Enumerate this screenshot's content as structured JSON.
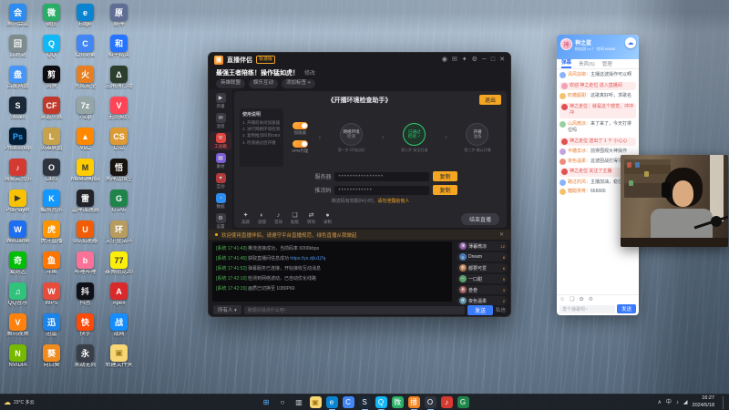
{
  "desktop": {
    "icons": [
      {
        "label": "腾讯会议",
        "color": "#2d8cf0",
        "glyph": "会"
      },
      {
        "label": "回收站",
        "color": "#7f8c8d",
        "glyph": "回"
      },
      {
        "label": "百度网盘",
        "color": "#4696fa",
        "glyph": "盘"
      },
      {
        "label": "Steam",
        "color": "#1b2838",
        "glyph": "S"
      },
      {
        "label": "Photoshop",
        "color": "#001e36",
        "glyph": "Ps",
        "fg": "#31a8ff"
      },
      {
        "label": "网易云音乐",
        "color": "#d33a31",
        "glyph": "♪"
      },
      {
        "label": "PotPlayer",
        "color": "#f8c200",
        "glyph": "▶",
        "fg": "#333"
      },
      {
        "label": "WeGame",
        "color": "#1d6ef0",
        "glyph": "W"
      },
      {
        "label": "爱奇艺",
        "color": "#00be06",
        "glyph": "奇"
      },
      {
        "label": "QQ音乐",
        "color": "#31c27c",
        "glyph": "♫"
      },
      {
        "label": "腾讯视频",
        "color": "#ff820f",
        "glyph": "V"
      },
      {
        "label": "NVIDIA",
        "color": "#76b900",
        "glyph": "N"
      },
      {
        "label": "微信",
        "color": "#2aae67",
        "glyph": "微"
      },
      {
        "label": "QQ",
        "color": "#12b7f5",
        "glyph": "Q"
      },
      {
        "label": "剪映",
        "color": "#0e0e12",
        "glyph": "剪"
      },
      {
        "label": "穿越火线",
        "color": "#c0392b",
        "glyph": "CF"
      },
      {
        "label": "英雄联盟",
        "color": "#c8a24b",
        "glyph": "L"
      },
      {
        "label": "OBS",
        "color": "#2f343f",
        "glyph": "O"
      },
      {
        "label": "酷狗音乐",
        "color": "#1298ff",
        "glyph": "K"
      },
      {
        "label": "虎牙直播",
        "color": "#ff9600",
        "glyph": "虎"
      },
      {
        "label": "斗鱼",
        "color": "#ff7500",
        "glyph": "鱼"
      },
      {
        "label": "WPS",
        "color": "#e84c3d",
        "glyph": "W"
      },
      {
        "label": "迅雷",
        "color": "#1c83e9",
        "glyph": "迅"
      },
      {
        "label": "向日葵",
        "color": "#f08c1e",
        "glyph": "葵"
      },
      {
        "label": "Edge",
        "color": "#0a84d0",
        "glyph": "e"
      },
      {
        "label": "Chrome",
        "color": "#4285f4",
        "glyph": "C"
      },
      {
        "label": "火绒安全",
        "color": "#e67e22",
        "glyph": "火"
      },
      {
        "label": "7-Zip",
        "color": "#95a5a6",
        "glyph": "7z"
      },
      {
        "label": "VLC",
        "color": "#ff8800",
        "glyph": "▲"
      },
      {
        "label": "MuMu模拟器",
        "color": "#ffcc00",
        "glyph": "M",
        "fg": "#333"
      },
      {
        "label": "雷神加速器",
        "color": "#23242a",
        "glyph": "雷"
      },
      {
        "label": "UU加速器",
        "color": "#f25c05",
        "glyph": "U"
      },
      {
        "label": "哔哩哔哩",
        "color": "#fb7299",
        "glyph": "b"
      },
      {
        "label": "抖音",
        "color": "#101018",
        "glyph": "抖"
      },
      {
        "label": "快手",
        "color": "#ff4906",
        "glyph": "快"
      },
      {
        "label": "永劫无间",
        "color": "#3a3f47",
        "glyph": "永"
      },
      {
        "label": "原神",
        "color": "#5f6e94",
        "glyph": "原"
      },
      {
        "label": "和平精英",
        "color": "#2574ff",
        "glyph": "和"
      },
      {
        "label": "三角洲行动",
        "color": "#2c3e2e",
        "glyph": "Δ"
      },
      {
        "label": "无畏契约",
        "color": "#fd4556",
        "glyph": "V"
      },
      {
        "label": "CS2",
        "color": "#de9b35",
        "glyph": "CS"
      },
      {
        "label": "黑神话悟空",
        "color": "#17130f",
        "glyph": "悟"
      },
      {
        "label": "GTA5",
        "color": "#1e8449",
        "glyph": "G"
      },
      {
        "label": "艾尔登法环",
        "color": "#b79b5f",
        "glyph": "环"
      },
      {
        "label": "赛博朋克2077",
        "color": "#fcee0a",
        "glyph": "77",
        "fg": "#333"
      },
      {
        "label": "Apex",
        "color": "#da292a",
        "glyph": "A"
      },
      {
        "label": "战网",
        "color": "#148eff",
        "glyph": "战"
      },
      {
        "label": "新建文件夹",
        "color": "#f7d674",
        "glyph": "▣",
        "fg": "#a07c1e"
      }
    ]
  },
  "app": {
    "title": "直播伴侣",
    "logo_glyph": "播",
    "version": "极速版",
    "titlebar_icons": [
      {
        "name": "user-icon",
        "glyph": "◉"
      },
      {
        "name": "message-icon",
        "glyph": "✉"
      },
      {
        "name": "skin-icon",
        "glyph": "✦"
      },
      {
        "name": "settings-icon",
        "glyph": "⚙"
      },
      {
        "name": "minimize-icon",
        "glyph": "─"
      },
      {
        "name": "maximize-icon",
        "glyph": "□"
      },
      {
        "name": "close-icon",
        "glyph": "✕"
      }
    ],
    "room": {
      "title": "最强王者陪练！操作猛如虎！",
      "edit": "修改",
      "tags": [
        "英雄联盟",
        "娱乐互动",
        "添加标签 +"
      ]
    },
    "nav": [
      {
        "label": "开播",
        "glyph": "▶",
        "color": "#3a3a42",
        "active": false
      },
      {
        "label": "消息",
        "glyph": "✉",
        "color": "#3a3a42",
        "active": false
      },
      {
        "label": "工具箱",
        "glyph": "⚒",
        "color": "#e0443e",
        "active": true
      },
      {
        "label": "素材",
        "glyph": "▦",
        "color": "#7b5bd6",
        "active": false
      },
      {
        "label": "互动",
        "glyph": "♥",
        "color": "#b03a3a",
        "active": false
      },
      {
        "label": "数据",
        "glyph": "◔",
        "color": "#2d8cf0",
        "active": false
      },
      {
        "label": "设置",
        "glyph": "⚙",
        "color": "#3a3a42",
        "active": false
      }
    ],
    "wizard": {
      "title": "《开播环境检查助手》",
      "exit": "退出",
      "note_title": "使用说明",
      "note_lines": [
        "1. 开播前关闭加速器",
        "2. 进行网络环境检测",
        "3. 复制推流码到OBS",
        "4. 检测通过后开播"
      ],
      "toggles": [
        {
          "label": "加速器"
        },
        {
          "label": "VPN代理"
        }
      ],
      "steps": [
        {
          "line1": "网络环境",
          "line2": "检测",
          "state": "normal",
          "caption": "第一步·环境自检"
        },
        {
          "line1": "已通过",
          "line2": "检测 ✓",
          "state": "done",
          "caption": "第二步·安全扫描"
        },
        {
          "line1": "开播",
          "line2": "准备",
          "state": "normal",
          "caption": "第三步·确认开播"
        }
      ],
      "fields": [
        {
          "label": "服务器",
          "value": "••••••••••••••••",
          "button": "复制"
        },
        {
          "label": "推流码",
          "value": "••••••••••••",
          "button": "复制"
        }
      ],
      "tip_plain": "推流码有效期24小时，",
      "tip_em": "请勿泄露给他人"
    },
    "tools": [
      {
        "label": "美颜",
        "glyph": "✦"
      },
      {
        "label": "滤镜",
        "glyph": "◐"
      },
      {
        "label": "音效",
        "glyph": "♪"
      },
      {
        "label": "贴纸",
        "glyph": "❏"
      },
      {
        "label": "转场",
        "glyph": "⇄"
      },
      {
        "label": "录制",
        "glyph": "●"
      }
    ],
    "live_button": "结束直播",
    "notice": {
      "text": "欢迎使用直播伴侣，请遵守平台直播规范，绿色直播从我做起",
      "close": "✕"
    },
    "logs": [
      {
        "ts": "[系统 17:41:43]",
        "msg": "推流连接成功，当前码率 6000kbps",
        "link": ""
      },
      {
        "ts": "[系统 17:41:45]",
        "msg": "获取直播间信息成功 ",
        "link": "https://ys.dj/u1j7q"
      },
      {
        "ts": "[系统 17:41:52]",
        "msg": "弹幕服务已连接，开始接收互动消息",
        "link": ""
      },
      {
        "ts": "[系统 17:42:10]",
        "msg": "检测到网络波动，已自动优化线路",
        "link": ""
      },
      {
        "ts": "[系统 17:42:15]",
        "msg": "画质已切换至 1080P60",
        "link": ""
      }
    ],
    "viewers": [
      {
        "name": "薄暮微凉",
        "badge": "12"
      },
      {
        "name": "Dream",
        "badge": "8"
      },
      {
        "name": "都要可爱",
        "badge": "6"
      },
      {
        "name": "一口甜",
        "badge": "5"
      },
      {
        "name": "叁叁",
        "badge": "3"
      },
      {
        "name": "夜色温柔",
        "badge": "2"
      }
    ],
    "chatbar": {
      "target": "所有人 ▾",
      "placeholder": "和观众说点什么吧~",
      "send": "发送",
      "dm": "私信"
    }
  },
  "chat_panel": {
    "header": {
      "avatar_glyph": "神",
      "name": "神之蓝",
      "sub": "粉丝团 Lv.7 · 房间 66666",
      "cloud": "☁"
    },
    "tabs": [
      {
        "label": "弹幕",
        "active": true
      },
      {
        "label": "贵宾(6)",
        "active": false
      },
      {
        "label": "管理",
        "active": false
      }
    ],
    "messages": [
      {
        "name": "清风扶柳：",
        "text": "主播这波操作可以啊",
        "hl": false,
        "av": "#8ab4f8"
      },
      {
        "name": "",
        "text": "欢迎 神之走位 进入直播间",
        "hl": true,
        "av": "#f2a0b5"
      },
      {
        "name": "奶糖超甜：",
        "text": "这歌真好听，求歌名",
        "hl": false,
        "av": "#f5c26b"
      },
      {
        "name": "神之走位：",
        "text": "就是这个感觉，冲冲冲",
        "hl": true,
        "av": "#e05252"
      },
      {
        "name": "山风微凉：",
        "text": "来了来了，今天打排位吗",
        "hl": false,
        "av": "#9ad0a0"
      },
      {
        "name": "",
        "text": "神之走位 送出了 1 个 小心心",
        "hl": true,
        "av": "#e05252"
      },
      {
        "name": "半糖去冰：",
        "text": "前排围观大神操作",
        "hl": false,
        "av": "#c5a3e0"
      },
      {
        "name": "夜色温柔：",
        "text": "这波团战打得漂亮",
        "hl": false,
        "av": "#f08c7a"
      },
      {
        "name": "",
        "text": "神之走位 关注了主播",
        "hl": true,
        "av": "#e05252"
      },
      {
        "name": "路过的风：",
        "text": "主播加油，稳住节奏",
        "hl": false,
        "av": "#8ab4f8"
      },
      {
        "name": "糖醋排骨：",
        "text": "666666",
        "hl": false,
        "av": "#f5c26b"
      }
    ],
    "footer": {
      "icons": [
        {
          "name": "emoji-icon",
          "glyph": "☺"
        },
        {
          "name": "image-icon",
          "glyph": "❏"
        },
        {
          "name": "gift-icon",
          "glyph": "✿"
        },
        {
          "name": "settings-icon",
          "glyph": "⚙"
        }
      ],
      "placeholder": "发个弹幕呗~",
      "send": "发送"
    }
  },
  "taskbar": {
    "weather": {
      "icon": "☁",
      "temp": "23°C",
      "desc": "多云"
    },
    "apps": [
      {
        "name": "start-button",
        "glyph": "⊞",
        "color": "transparent",
        "fg": "#5ab4ff",
        "running": false
      },
      {
        "name": "search-icon",
        "glyph": "○",
        "color": "transparent",
        "fg": "#d8d8de",
        "running": false
      },
      {
        "name": "task-view-icon",
        "glyph": "▥",
        "color": "transparent",
        "fg": "#d8d8de",
        "running": false
      },
      {
        "name": "explorer-icon",
        "glyph": "▣",
        "color": "#f7d674",
        "fg": "#a07c1e",
        "running": false
      },
      {
        "name": "edge-icon",
        "glyph": "e",
        "color": "#0a84d0",
        "fg": "#fff",
        "running": true
      },
      {
        "name": "chrome-icon",
        "glyph": "C",
        "color": "#4285f4",
        "fg": "#fff",
        "running": false
      },
      {
        "name": "steam-icon",
        "glyph": "S",
        "color": "#1b2838",
        "fg": "#fff",
        "running": true
      },
      {
        "name": "qq-icon",
        "glyph": "Q",
        "color": "#12b7f5",
        "fg": "#fff",
        "running": true
      },
      {
        "name": "wechat-icon",
        "glyph": "微",
        "color": "#2aae67",
        "fg": "#fff",
        "running": false
      },
      {
        "name": "live-companion-icon",
        "glyph": "播",
        "color": "#f5831f",
        "fg": "#fff",
        "running": true
      },
      {
        "name": "obs-icon",
        "glyph": "O",
        "color": "#2f343f",
        "fg": "#fff",
        "running": true
      },
      {
        "name": "netease-music-icon",
        "glyph": "♪",
        "color": "#d33a31",
        "fg": "#fff",
        "running": false
      },
      {
        "name": "game-icon",
        "glyph": "G",
        "color": "#1e8449",
        "fg": "#fff",
        "running": false
      }
    ],
    "tray": [
      {
        "name": "tray-expand-icon",
        "glyph": "∧"
      },
      {
        "name": "ime-indicator",
        "glyph": "中"
      },
      {
        "name": "volume-icon",
        "glyph": "♪"
      },
      {
        "name": "network-icon",
        "glyph": "◢"
      }
    ],
    "time": "16:27",
    "date": "2024/5/18"
  }
}
